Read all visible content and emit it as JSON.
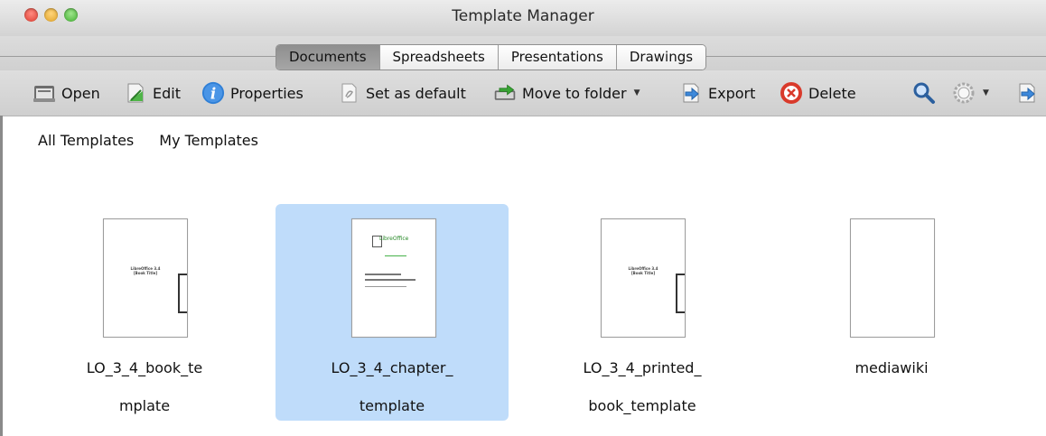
{
  "window": {
    "title": "Template Manager"
  },
  "tabs": [
    {
      "label": "Documents",
      "active": true
    },
    {
      "label": "Spreadsheets",
      "active": false
    },
    {
      "label": "Presentations",
      "active": false
    },
    {
      "label": "Drawings",
      "active": false
    }
  ],
  "toolbar": {
    "open": {
      "label": "Open",
      "icon": "folder-open-icon"
    },
    "edit": {
      "label": "Edit",
      "icon": "edit-document-icon"
    },
    "properties": {
      "label": "Properties",
      "icon": "info-icon"
    },
    "set_default": {
      "label": "Set as default",
      "icon": "set-default-icon"
    },
    "move": {
      "label": "Move to folder",
      "icon": "move-folder-icon"
    },
    "export": {
      "label": "Export",
      "icon": "export-icon"
    },
    "delete": {
      "label": "Delete",
      "icon": "delete-icon"
    },
    "search_icon": "search-icon",
    "settings_icon": "gear-icon",
    "import_icon": "import-icon"
  },
  "views": [
    "All Templates",
    "My Templates"
  ],
  "templates": [
    {
      "line1": "LO_3_4_book_te",
      "line2": "mplate",
      "thumb_text": "LibreOffice 3.4\n[Book Title]",
      "selected": false
    },
    {
      "line1": "LO_3_4_chapter_",
      "line2": "template",
      "thumb_text": "LibreOffice",
      "selected": true
    },
    {
      "line1": "LO_3_4_printed_",
      "line2": "book_template",
      "thumb_text": "LibreOffice 3.4\n[Book Title]",
      "selected": false
    },
    {
      "line1": "mediawiki",
      "line2": "",
      "thumb_text": "",
      "selected": false
    }
  ],
  "colors": {
    "selection": "#bfdcfa",
    "active_tab": "#9a9a9a"
  }
}
